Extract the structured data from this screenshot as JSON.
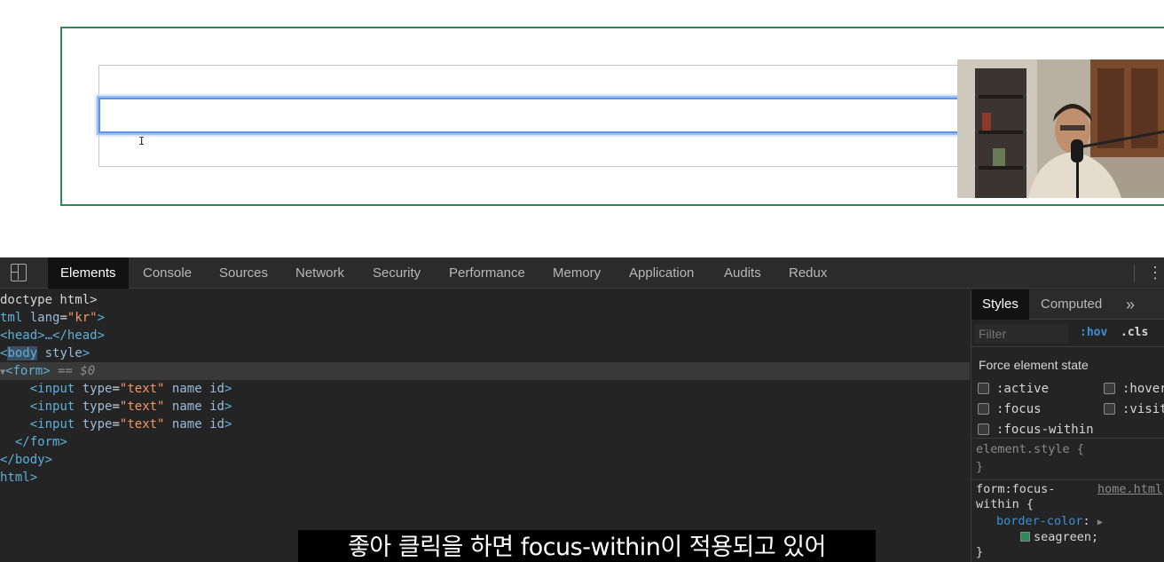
{
  "devtools": {
    "tabs": [
      "Elements",
      "Console",
      "Sources",
      "Network",
      "Security",
      "Performance",
      "Memory",
      "Application",
      "Audits",
      "Redux"
    ],
    "active_tab": "Elements"
  },
  "dom": {
    "doctype": "doctype html>",
    "html_open_tag": "tml",
    "html_lang_attr": "lang",
    "html_lang_val": "\"kr\"",
    "head": "<head>…</head>",
    "body_tag": "body",
    "body_attr": "style",
    "form_tag": "form",
    "form_marker": "== $0",
    "input_tag": "input",
    "input_type_attr": "type",
    "input_type_val": "\"text\"",
    "input_name_attr": "name",
    "input_id_attr": "id",
    "form_close": "</form>",
    "body_close": "</body>",
    "html_close": "html>"
  },
  "styles": {
    "tabs": [
      "Styles",
      "Computed"
    ],
    "more": "»",
    "filter_placeholder": "Filter",
    "hov": ":hov",
    "cls": ".cls",
    "force_label": "Force element state",
    "states": [
      ":active",
      ":hover",
      ":focus",
      ":visited",
      ":focus-within"
    ],
    "element_style": "element.style {\n}",
    "rule": {
      "selector": "form:focus-within {",
      "source": "home.html",
      "property": "border-color",
      "value": "seagreen;",
      "close": "}"
    }
  },
  "subtitle": "좋아 클릭을 하면 focus-within이 적용되고 있어",
  "colors": {
    "form_border": "#2e8b57",
    "focus_ring": "#5b95e8",
    "swatch": "#2e8b57"
  }
}
